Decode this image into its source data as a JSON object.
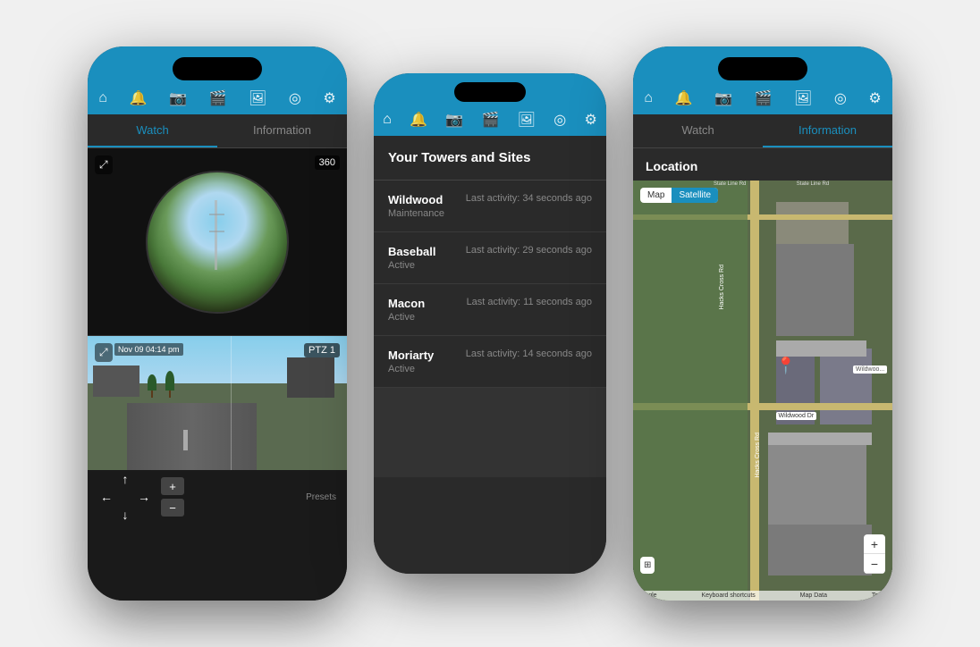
{
  "phone1": {
    "tabs": [
      {
        "label": "Watch",
        "active": true
      },
      {
        "label": "Information",
        "active": false
      }
    ],
    "fisheye": {
      "badge": "360",
      "expand_icon": "⤢"
    },
    "ptz": {
      "badge": "PTZ 1",
      "timestamp": "Nov 09 04:14 pm",
      "expand_icon": "⤢"
    },
    "controls": {
      "up": "↑",
      "down": "↓",
      "left": "←",
      "right": "→",
      "zoom_in": "+",
      "zoom_out": "−",
      "presets": "Presets"
    }
  },
  "phone2": {
    "header": "Your Towers and Sites",
    "sites": [
      {
        "name": "Wildwood",
        "status": "Maintenance",
        "activity": "Last activity: 34 seconds ago"
      },
      {
        "name": "Baseball",
        "status": "Active",
        "activity": "Last activity: 29 seconds ago"
      },
      {
        "name": "Macon",
        "status": "Active",
        "activity": "Last activity: 11 seconds ago"
      },
      {
        "name": "Moriarty",
        "status": "Active",
        "activity": "Last activity: 14 seconds ago"
      }
    ]
  },
  "phone3": {
    "tabs": [
      {
        "label": "Watch",
        "active": false
      },
      {
        "label": "Information",
        "active": true
      }
    ],
    "location_header": "Location",
    "map": {
      "tab_map": "Map",
      "tab_satellite": "Satellite",
      "zoom_in": "+",
      "zoom_out": "−",
      "attribution": "Google",
      "label_wildwood": "Wildwood Dr",
      "keyboard_shortcuts": "Keyboard shortcuts",
      "map_data": "Map Data",
      "terms": "Terms"
    }
  },
  "nav_icons": {
    "home": "⌂",
    "bell": "🔔",
    "camera": "📷",
    "video": "🎬",
    "gallery": "🖼",
    "eye": "◎",
    "settings": "⚙"
  }
}
